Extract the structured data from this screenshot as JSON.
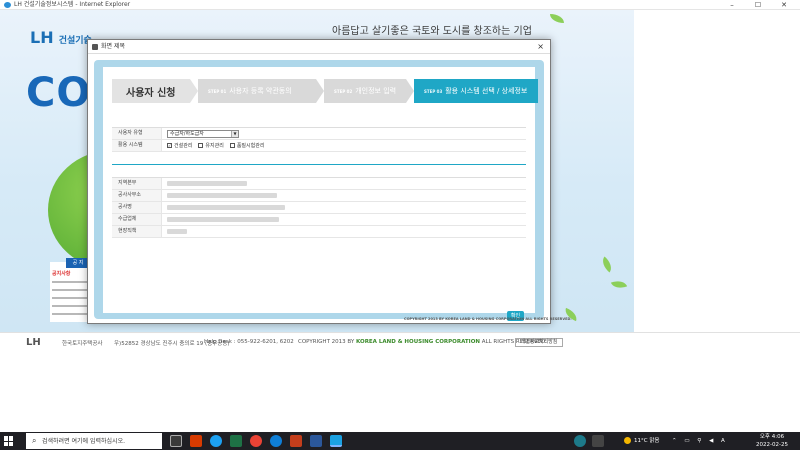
{
  "browser": {
    "title": "LH 건설기술정보시스템 - Internet Explorer",
    "min": "–",
    "max": "☐",
    "close": "✕"
  },
  "background": {
    "logo": "LH",
    "logo_sub": "건설기술",
    "brand": "COT",
    "slogan": "아름답고 살기좋은 국토와 도시를 창조하는 기업",
    "left_panel_head": "공 지",
    "left_panel_sub": "공지사항",
    "footer_logo": "LH",
    "footer_company": "한국토지주택공사",
    "footer_address": "우)52852 경상남도 진주시 충의로 19 (충무공동)",
    "footer_help": "Help Desk : 055-922-6201, 6202",
    "footer_copyright_pre": "COPYRIGHT 2013 BY ",
    "footer_copyright_brand": "KOREA LAND & HOUSING CORPORATION",
    "footer_copyright_post": " ALL RIGHTS RESERVED.",
    "footer_button": "개인정보처리방침"
  },
  "modal": {
    "title": "화면 제목",
    "close": "×",
    "steps": [
      {
        "label": "사용자 신청"
      },
      {
        "num": "STEP 01",
        "label": "사용자 등록 약관동의"
      },
      {
        "num": "STEP 02",
        "label": "개인정보 입력"
      },
      {
        "num": "STEP 03",
        "label": "활용 시스템 선택 / 상세정보"
      }
    ],
    "form": {
      "user_type_label": "사용자 유형",
      "user_type_value": "수급자/하도급자",
      "system_label": "활용 시스템",
      "options": [
        {
          "label": "건설관리",
          "checked": true
        },
        {
          "label": "유지관리",
          "checked": false
        },
        {
          "label": "품질시험관리",
          "checked": false
        }
      ]
    },
    "info_labels": [
      "지역본부",
      "공사사무소",
      "공사명",
      "수급업체",
      "현장직책"
    ],
    "confirm": "확인",
    "copyright": "COPYRIGHT 2013 BY KOREA LAND & HOUSING CORPORATION ALL RIGHTS RESERVED."
  },
  "taskbar": {
    "search_placeholder": "검색하려면 여기에 입력하십시오.",
    "weather": "11°C 맑음",
    "time": "오후 4:06",
    "date": "2022-02-25",
    "icons": [
      "task-view",
      "explorer",
      "office",
      "twitter-bird",
      "excel",
      "chrome",
      "edge",
      "powerpoint",
      "word",
      "internet-explorer"
    ]
  }
}
